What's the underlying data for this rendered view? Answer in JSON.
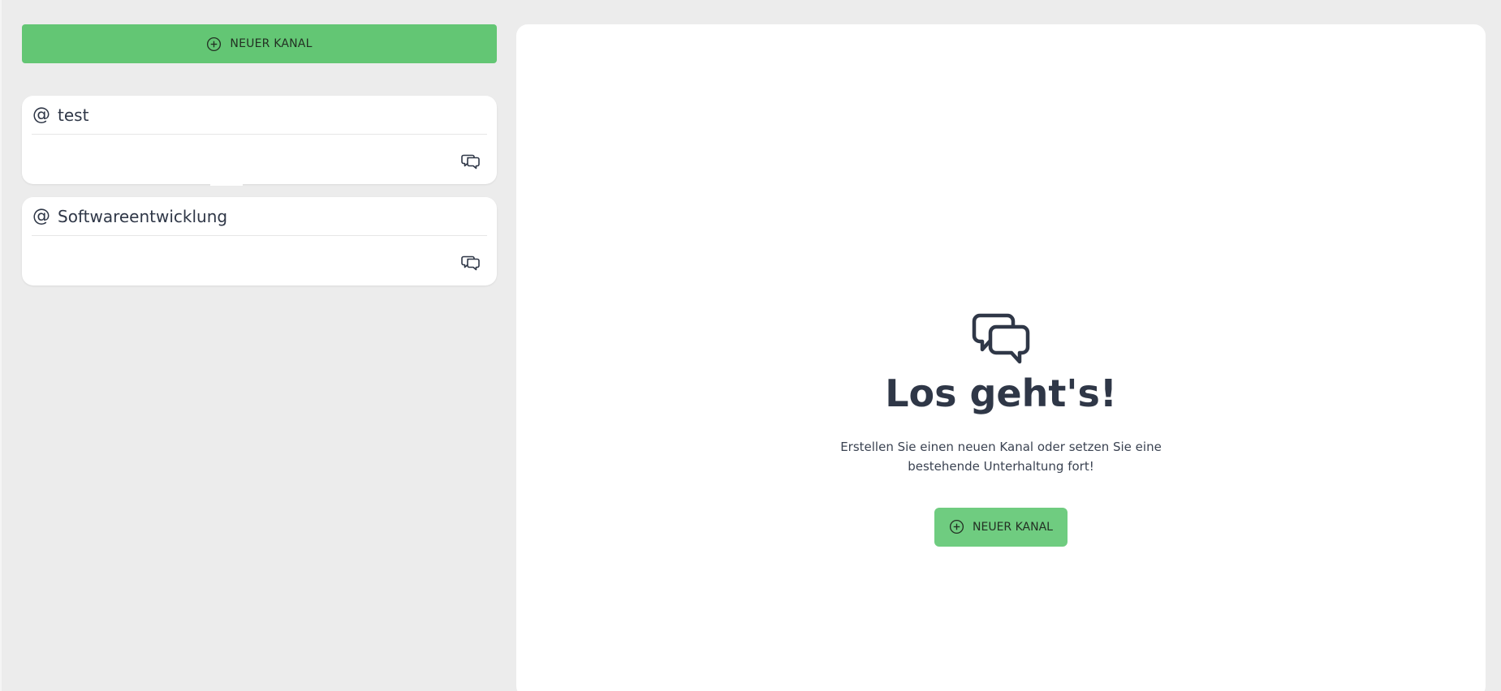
{
  "sidebar": {
    "new_channel_button": {
      "label": "NEUER KANAL",
      "icon": "plus-circle-icon"
    },
    "channels": [
      {
        "name": "test",
        "prefix_icon": "at-icon",
        "action_icon": "chat-bubbles-icon"
      },
      {
        "name": "Softwareentwicklung",
        "prefix_icon": "at-icon",
        "action_icon": "chat-bubbles-icon"
      }
    ]
  },
  "main": {
    "empty_state": {
      "icon": "chat-bubbles-icon",
      "title": "Los geht's!",
      "text": "Erstellen Sie einen neuen Kanal oder setzen Sie eine bestehende Unterhaltung fort!",
      "button_label": "NEUER KANAL",
      "button_icon": "plus-circle-icon"
    }
  },
  "colors": {
    "accent_green": "#63c674",
    "accent_green_light": "#6fcc80",
    "background": "#ececec",
    "panel": "#ffffff",
    "text_dark": "#2f3747"
  }
}
